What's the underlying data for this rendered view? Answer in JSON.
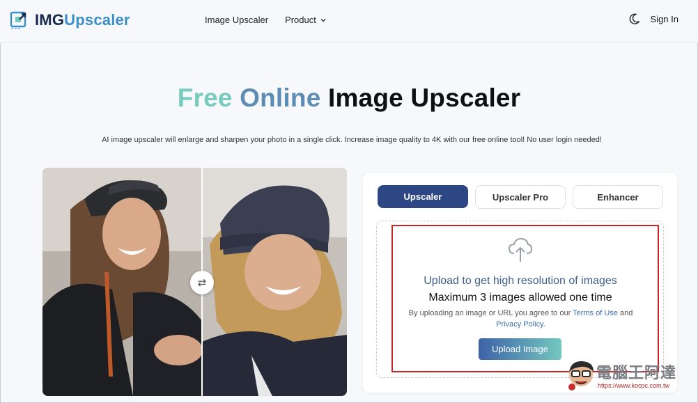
{
  "header": {
    "logo": {
      "img": "IMG",
      "up": "Upscaler"
    },
    "nav": [
      {
        "label": "Image Upscaler"
      },
      {
        "label": "Product"
      }
    ],
    "sign_in": "Sign In"
  },
  "hero": {
    "title_free": "Free",
    "title_online": "Online",
    "title_rest": "Image Upscaler",
    "subtitle": "AI image upscaler will enlarge and sharpen your photo in a single click. Increase image quality to 4K with our free online tool! No user login needed!"
  },
  "compare": {
    "swap_glyph": "⇄"
  },
  "panel": {
    "tabs": [
      {
        "label": "Upscaler"
      },
      {
        "label": "Upscaler Pro"
      },
      {
        "label": "Enhancer"
      }
    ],
    "upload_title": "Upload to get high resolution of images",
    "max_text": "Maximum 3 images allowed one time",
    "terms_prefix": "By uploading an image or URL you agree to our",
    "terms_link": "Terms of Use",
    "terms_and": "and",
    "privacy_link": "Privacy Policy",
    "terms_suffix": ".",
    "upload_button": "Upload Image"
  },
  "watermark": {
    "text": "電腦王阿達",
    "url": "https://www.kocpc.com.tw"
  },
  "colors": {
    "accent_dark": "#2c4783",
    "gradient_start": "#3d62a8",
    "gradient_end": "#74c7bf",
    "highlight_red": "#c8262b"
  }
}
